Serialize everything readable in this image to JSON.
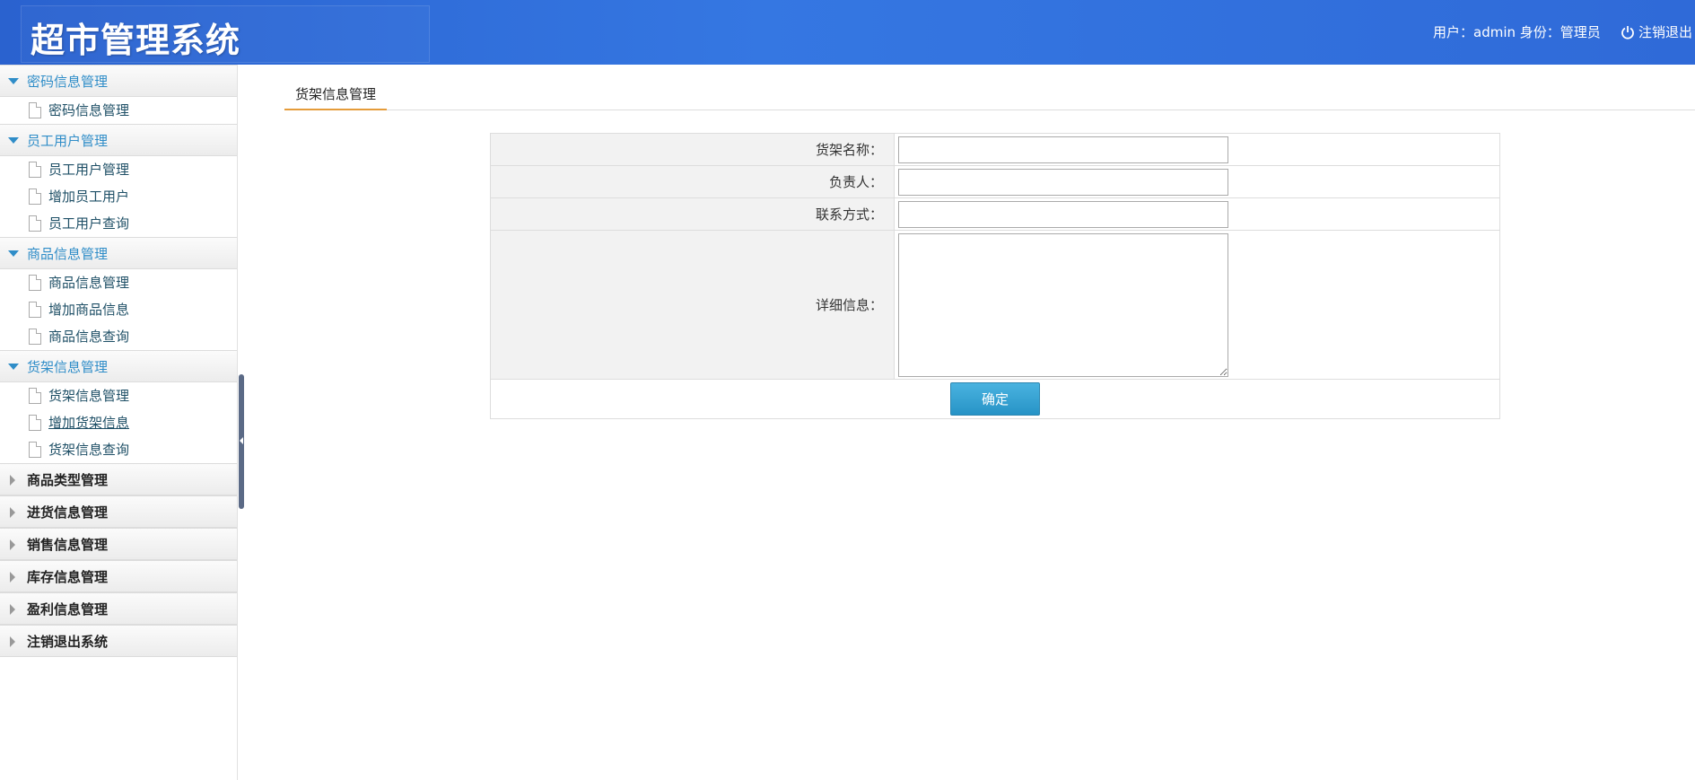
{
  "header": {
    "title": "超市管理系统",
    "user_info": "用户：admin 身份：管理员",
    "logout_label": "注销退出"
  },
  "sidebar": {
    "groups": [
      {
        "label": "密码信息管理",
        "open": true,
        "items": [
          {
            "label": "密码信息管理"
          }
        ]
      },
      {
        "label": "员工用户管理",
        "open": true,
        "items": [
          {
            "label": "员工用户管理"
          },
          {
            "label": "增加员工用户"
          },
          {
            "label": "员工用户查询"
          }
        ]
      },
      {
        "label": "商品信息管理",
        "open": true,
        "items": [
          {
            "label": "商品信息管理"
          },
          {
            "label": "增加商品信息"
          },
          {
            "label": "商品信息查询"
          }
        ]
      },
      {
        "label": "货架信息管理",
        "open": true,
        "items": [
          {
            "label": "货架信息管理"
          },
          {
            "label": "增加货架信息"
          },
          {
            "label": "货架信息查询"
          }
        ]
      },
      {
        "label": "商品类型管理",
        "open": false
      },
      {
        "label": "进货信息管理",
        "open": false
      },
      {
        "label": "销售信息管理",
        "open": false
      },
      {
        "label": "库存信息管理",
        "open": false
      },
      {
        "label": "盈利信息管理",
        "open": false
      },
      {
        "label": "注销退出系统",
        "open": false
      }
    ]
  },
  "main": {
    "tab_label": "货架信息管理",
    "form": {
      "name_label": "货架名称：",
      "name_value": "",
      "manager_label": "负责人：",
      "manager_value": "",
      "contact_label": "联系方式：",
      "contact_value": "",
      "detail_label": "详细信息：",
      "detail_value": "",
      "submit_label": "确定"
    }
  },
  "colors": {
    "header_blue": "#3577e2",
    "accent_blue": "#2f8dc8",
    "tab_underline": "#e59c3a"
  }
}
